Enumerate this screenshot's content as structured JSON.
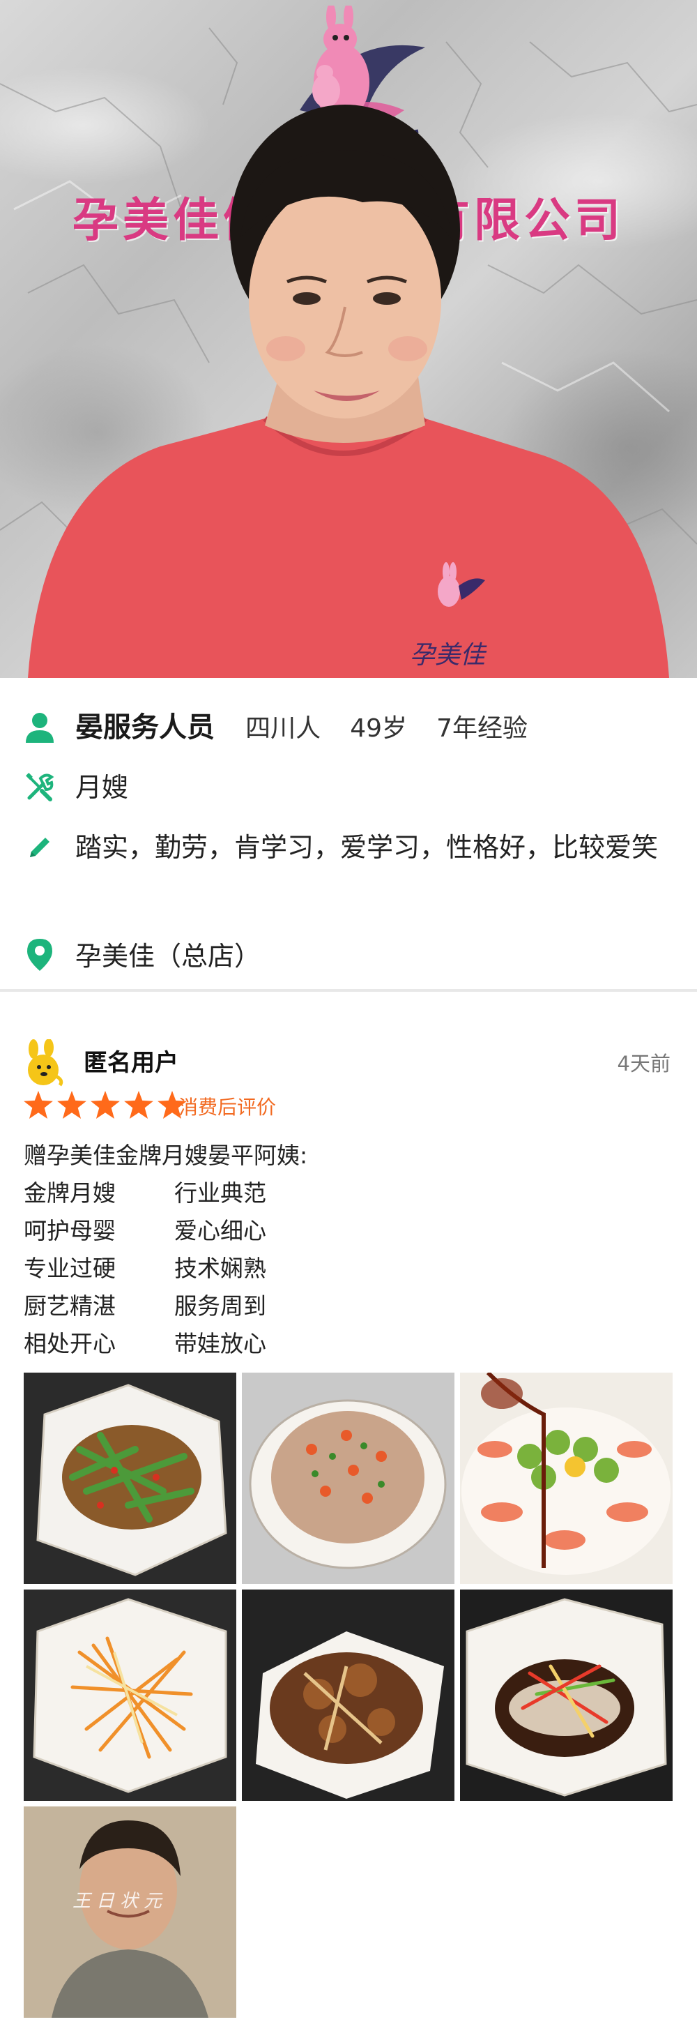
{
  "hero": {
    "company_name": "孕美佳健康管理有限公司",
    "logo_brand": "孕美佳",
    "shirt_logo_text": "孕美佳"
  },
  "profile": {
    "name": "晏服务人员",
    "origin": "四川人",
    "age": "49岁",
    "experience": "7年经验",
    "role": "月嫂",
    "description": "踏实，勤劳，肯学习，爱学习，性格好，比较爱笑",
    "store": "孕美佳（总店）",
    "icons": {
      "person": "person-icon",
      "tools": "tools-icon",
      "description": "pencil-icon",
      "location": "location-pin-icon"
    },
    "accent_color": "#1db47c"
  },
  "review": {
    "user": "匿名用户",
    "time": "4天前",
    "rating": 5,
    "rating_max": 5,
    "tag": "消费后评价",
    "star_color": "#ff6a1a",
    "lines": [
      "赠孕美佳金牌月嫂晏平阿姨:"
    ],
    "couplets": [
      [
        "金牌月嫂",
        "行业典范"
      ],
      [
        "呵护母婴",
        "爱心细心"
      ],
      [
        "专业过硬",
        "技术娴熟"
      ],
      [
        "厨艺精湛",
        "服务周到"
      ],
      [
        "相处开心",
        "带娃放心"
      ]
    ],
    "photos": [
      "stir-fried-celery-dish",
      "minced-meat-dish",
      "okra-shrimp-dish",
      "shredded-vegetable-dish",
      "braised-meat-dish",
      "steamed-fish-dish",
      "video-frame-woman"
    ],
    "video_overlay_text": "王日状元"
  }
}
